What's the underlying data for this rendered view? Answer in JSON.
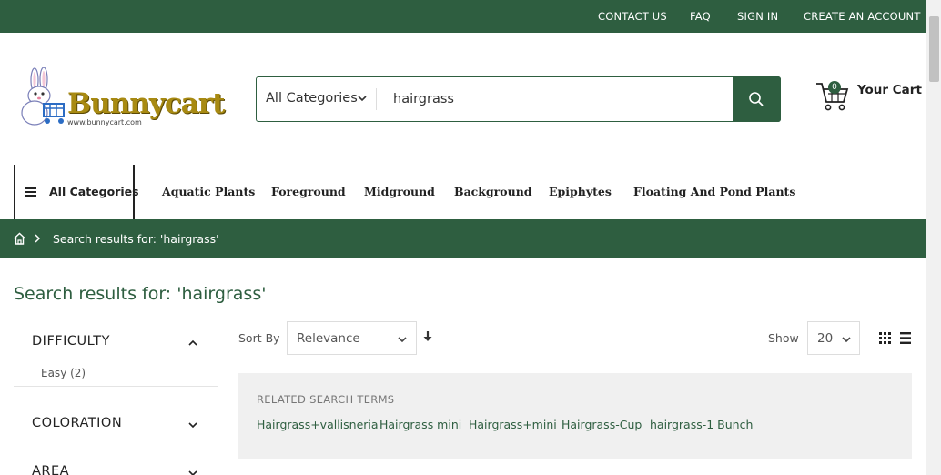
{
  "topbar": {
    "links": [
      "CONTACT US",
      "FAQ",
      "SIGN IN",
      "CREATE AN ACCOUNT"
    ]
  },
  "logo": {
    "wordmark": "Bunnycart",
    "url": "www.bunnycart.com"
  },
  "search": {
    "category": "All Categories",
    "query": "hairgrass"
  },
  "cart": {
    "count": "0",
    "label": "Your Cart"
  },
  "nav": {
    "all_categories": "All Categories",
    "items": [
      "Aquatic Plants",
      "Foreground",
      "Midground",
      "Background",
      "Epiphytes",
      "Floating And Pond Plants"
    ]
  },
  "breadcrumb": {
    "current": "Search results for: 'hairgrass'"
  },
  "page": {
    "title": "Search results for: 'hairgrass'"
  },
  "filters": [
    {
      "title": "DIFFICULTY",
      "expanded": true,
      "options": [
        "Easy (2)"
      ]
    },
    {
      "title": "COLORATION",
      "expanded": false
    },
    {
      "title": "AREA",
      "expanded": false
    }
  ],
  "toolbar": {
    "sort_label": "Sort By",
    "sort_value": "Relevance",
    "show_label": "Show",
    "show_value": "20"
  },
  "related": {
    "heading": "RELATED SEARCH TERMS",
    "terms": [
      "Hairgrass+vallisneria",
      "Hairgrass mini",
      "Hairgrass+mini",
      "Hairgrass-Cup",
      "hairgrass-1 Bunch"
    ]
  },
  "colors": {
    "brand_green": "#2e5e40",
    "logo_gold": "#a88a12"
  }
}
